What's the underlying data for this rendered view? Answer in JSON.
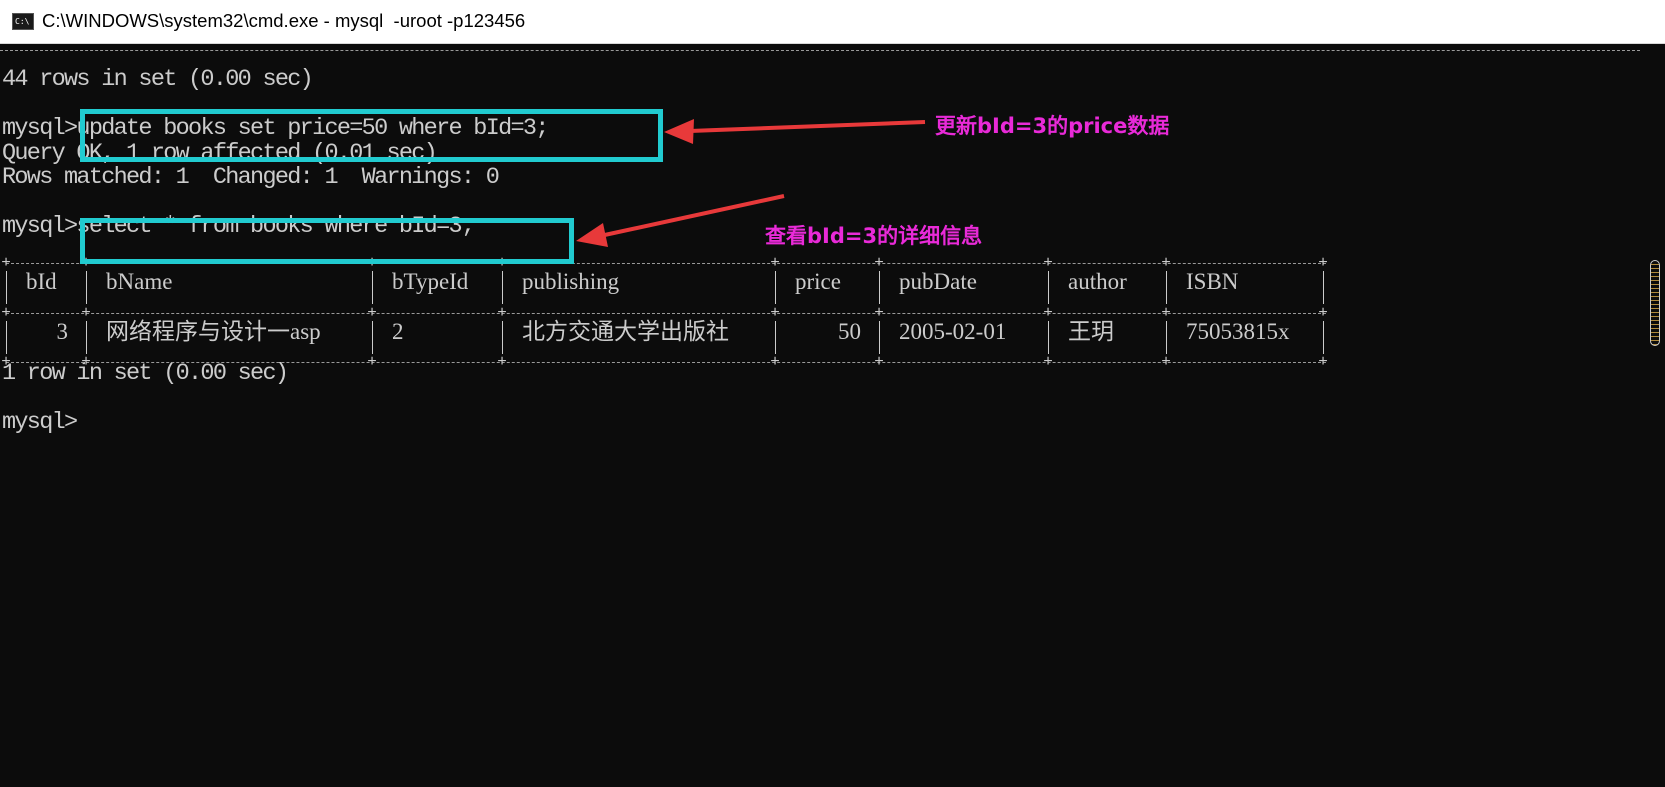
{
  "window": {
    "title": "C:\\WINDOWS\\system32\\cmd.exe - mysql  -uroot -p123456",
    "icon": "cmd-icon"
  },
  "console": {
    "rows_in_set_1": "44 rows in set (0.00 sec)",
    "prompt": "mysql>",
    "cmd_update": "update books set price=50 where bId=3;",
    "query_ok": "Query OK, 1 row affected (0.01 sec)",
    "rows_matched": "Rows matched: 1  Changed: 1  Warnings: 0",
    "cmd_select": "select * from books where bId=3;",
    "rows_in_set_2": "1 row in set (0.00 sec)",
    "final_prompt": "mysql>"
  },
  "result_table": {
    "columns": [
      "bId",
      "bName",
      "bTypeId",
      "publishing",
      "price",
      "pubDate",
      "author",
      "ISBN"
    ],
    "rows": [
      [
        "3",
        "网络程序与设计一asp",
        "2",
        "北方交通大学出版社",
        "50",
        "2005-02-01",
        "王玥",
        "75053815x"
      ]
    ]
  },
  "annotations": {
    "update_note": "更新bId=3的price数据",
    "select_note": "查看bId=3的详细信息"
  },
  "colors": {
    "background": "#0c0c0c",
    "text": "#cccccc",
    "highlight_box": "#21cbd0",
    "annotation_text": "#e92ad8",
    "arrow": "#e8393a"
  }
}
